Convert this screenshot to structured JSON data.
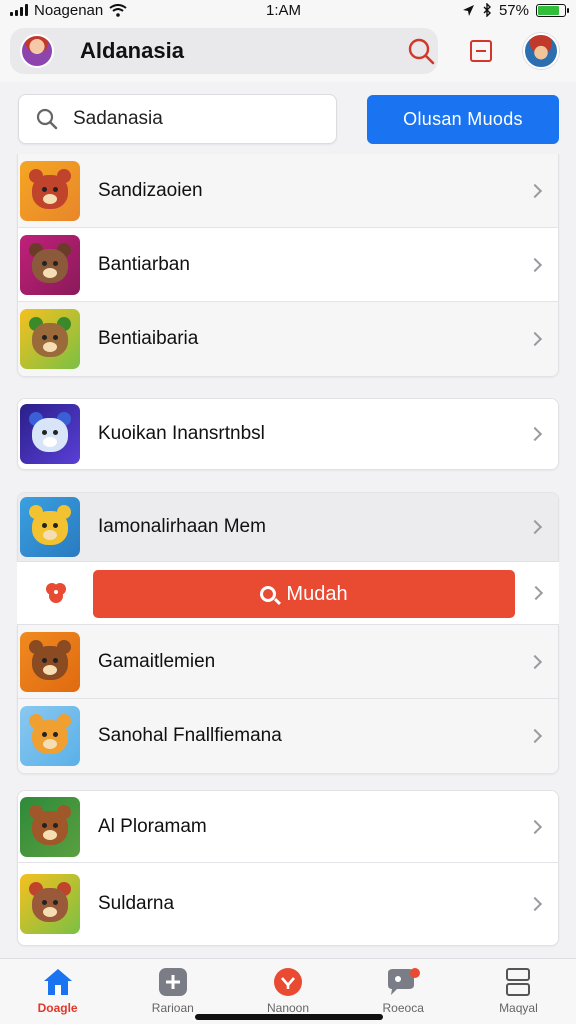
{
  "status_bar": {
    "carrier": "Noagenan",
    "time": "1:AM",
    "battery": "57%"
  },
  "header": {
    "title": "Aldanasia"
  },
  "search": {
    "value": "Sadanasia"
  },
  "primary_button": "Olusan Muods",
  "groups": [
    {
      "items": [
        {
          "label": "Sandizaoien",
          "colors": [
            "#f5a623",
            "#c0442b"
          ]
        },
        {
          "label": "Bantiarban",
          "colors": [
            "#c0207a",
            "#6b3b2a"
          ]
        },
        {
          "label": "Bentiaibaria",
          "colors": [
            "#7bc043",
            "#4a7a2a"
          ]
        }
      ]
    },
    {
      "items": [
        {
          "label": "Kuoikan Inansrtnbsl",
          "colors": [
            "#3b2fa8",
            "#3a5fd6"
          ]
        }
      ]
    },
    {
      "items": [
        {
          "label": "Iamonalirhaan Mem",
          "colors": [
            "#3aa0e0",
            "#f2c230"
          ]
        }
      ]
    },
    {
      "items": [
        {
          "label": "Gamaitlemien",
          "colors": [
            "#f08a1f",
            "#8a4a22"
          ]
        },
        {
          "label": "Sanohal Fnallfiemana",
          "colors": [
            "#5ab0e8",
            "#f0a030"
          ]
        }
      ]
    },
    {
      "items": [
        {
          "label": "Al Ploramam",
          "colors": [
            "#2e8a3a",
            "#a0582a"
          ]
        },
        {
          "label": "Suldarna",
          "colors": [
            "#7ac043",
            "#c0442b"
          ]
        }
      ]
    }
  ],
  "special_row": {
    "button_label": "Mudah"
  },
  "tabs": [
    {
      "label": "Doagle",
      "active": true
    },
    {
      "label": "Rarioan",
      "active": false
    },
    {
      "label": "Nanoon",
      "active": false
    },
    {
      "label": "Roeoca",
      "active": false
    },
    {
      "label": "Maqyal",
      "active": false
    }
  ]
}
